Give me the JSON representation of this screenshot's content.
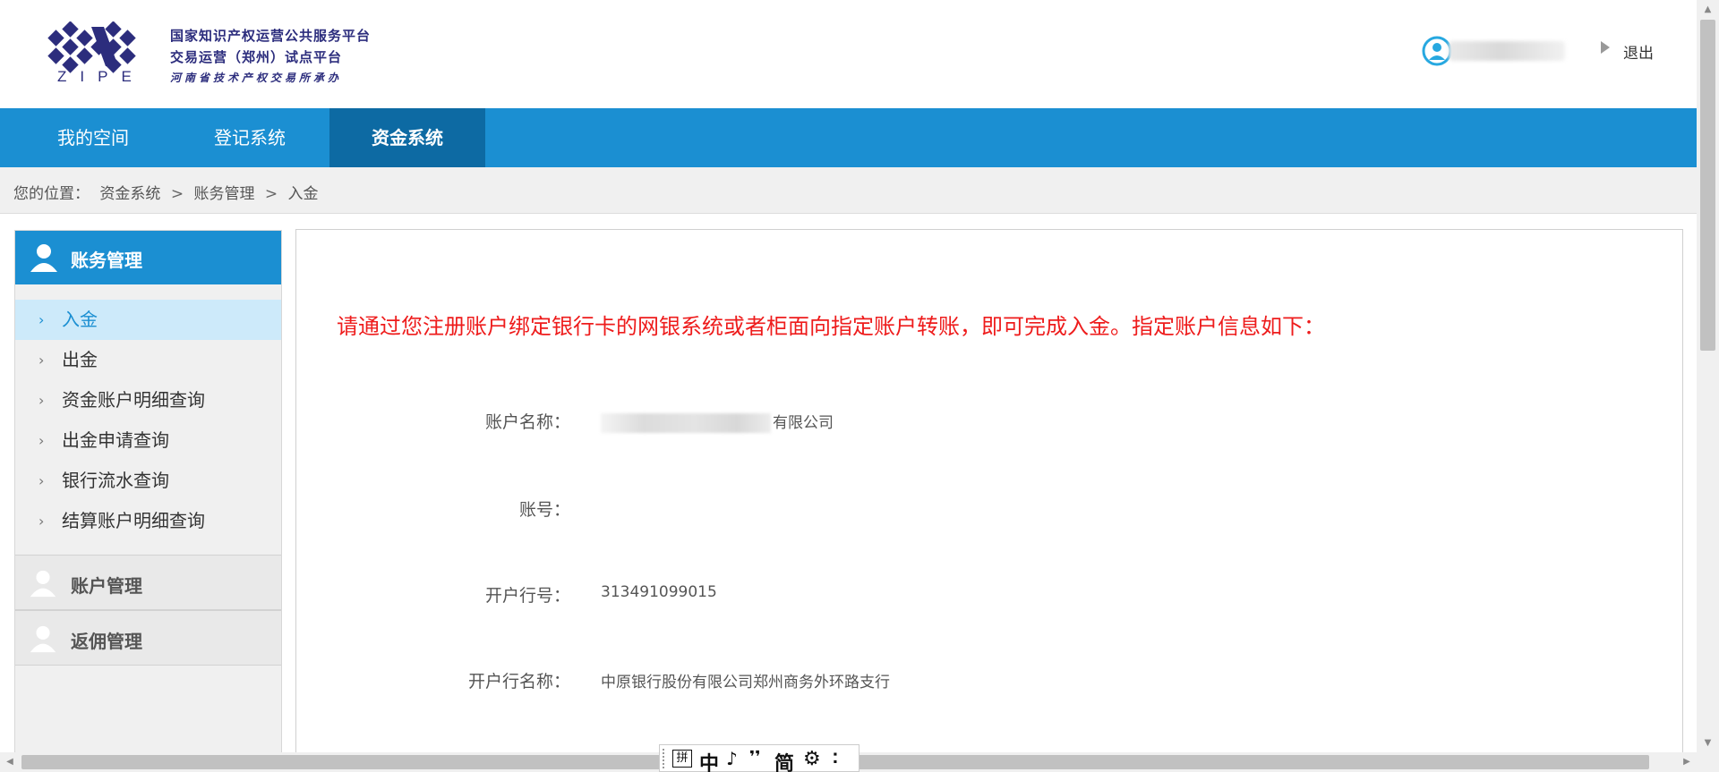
{
  "header": {
    "logo_text": "ZIPE",
    "platform_line1": "国家知识产权运营公共服务平台",
    "platform_line2": "交易运营（郑州）试点平台",
    "platform_line3": "河南省技术产权交易所承办",
    "logout_label": "退出",
    "brand_color": "#2c2d7d"
  },
  "nav": {
    "items": [
      {
        "label": "我的空间"
      },
      {
        "label": "登记系统"
      },
      {
        "label": "资金系统",
        "active": true
      }
    ],
    "color": "#1b8fd2",
    "active_color": "#0d6aa3"
  },
  "breadcrumb": {
    "prefix": "您的位置：",
    "items": [
      "资金系统",
      "账务管理",
      "入金"
    ],
    "separator": ">"
  },
  "sidebar": {
    "section_title": "账务管理",
    "items": [
      {
        "label": "入金",
        "active": true
      },
      {
        "label": "出金"
      },
      {
        "label": "资金账户明细查询"
      },
      {
        "label": "出金申请查询"
      },
      {
        "label": "银行流水查询"
      },
      {
        "label": "结算账户明细查询"
      }
    ],
    "groups": [
      {
        "label": "账户管理"
      },
      {
        "label": "返佣管理"
      }
    ],
    "chevron": "›"
  },
  "content": {
    "notice": "请通过您注册账户绑定银行卡的网银系统或者柜面向指定账户转账，即可完成入金。指定账户信息如下：",
    "notice_color": "#ee1c1c",
    "fields": [
      {
        "label": "账户名称：",
        "value": "有限公司"
      },
      {
        "label": "账号：",
        "value": ""
      },
      {
        "label": "开户行号：",
        "value": "313491099015"
      },
      {
        "label": "开户行名称：",
        "value": "中原银行股份有限公司郑州商务外环路支行"
      }
    ]
  },
  "ime": {
    "keys": [
      "拼",
      "中",
      "♪",
      "❜❜",
      "简",
      "⚙",
      "⠅"
    ]
  }
}
